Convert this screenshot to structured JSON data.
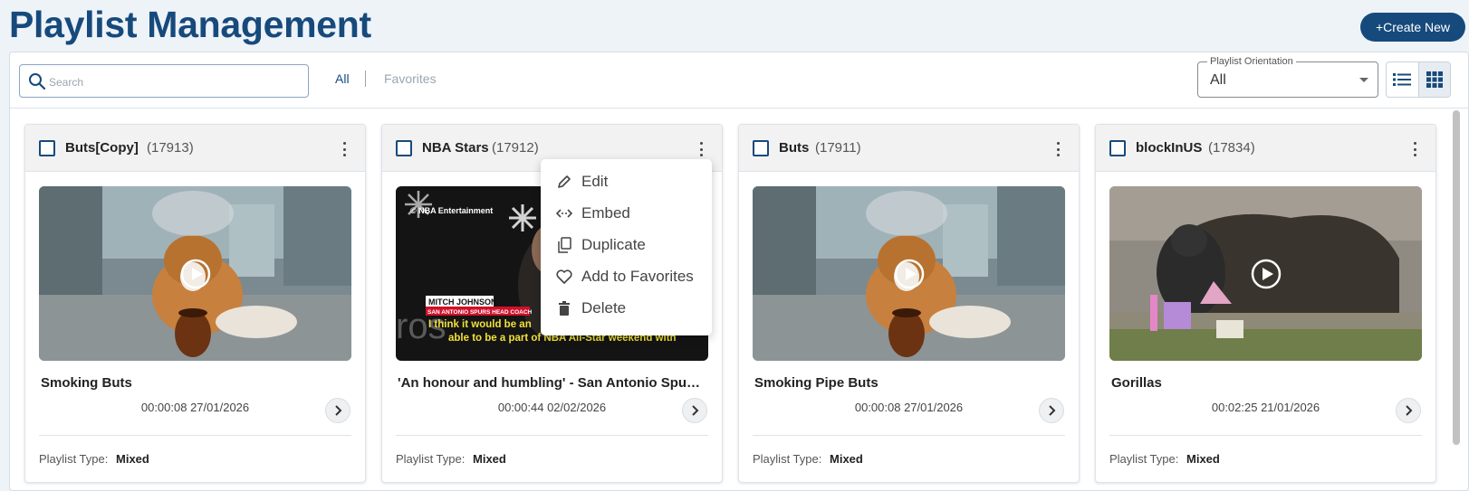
{
  "header": {
    "title": "Playlist Management",
    "create_label": "+Create New"
  },
  "toolbar": {
    "search_placeholder": "Search",
    "filter_all": "All",
    "filter_favorites": "Favorites",
    "orientation_label": "Playlist Orientation",
    "orientation_value": "All",
    "view_list_icon": "list-view-icon",
    "view_grid_icon": "grid-view-icon"
  },
  "cards": [
    {
      "name": "Buts[Copy]",
      "id": "(17913)",
      "video_title": "Smoking Buts",
      "meta": "00:00:08 27/01/2026",
      "type_label": "Playlist Type:",
      "type_value": "Mixed",
      "thumb": "dog-pipe"
    },
    {
      "name": "NBA Stars",
      "id": "(17912)",
      "video_title": "'An honour and humbling' - San Antonio Spurs' Mitch Johnson",
      "meta": "00:00:44 02/02/2026",
      "type_label": "Playlist Type:",
      "type_value": "Mixed",
      "thumb": "nba"
    },
    {
      "name": "Buts",
      "id": "(17911)",
      "video_title": "Smoking Pipe Buts",
      "meta": "00:00:08 27/01/2026",
      "type_label": "Playlist Type:",
      "type_value": "Mixed",
      "thumb": "dog-pipe"
    },
    {
      "name": "blockInUS",
      "id": "(17834)",
      "video_title": "Gorillas",
      "meta": "00:02:25 21/01/2026",
      "type_label": "Playlist Type:",
      "type_value": "Mixed",
      "thumb": "gorilla"
    }
  ],
  "nba_thumb": {
    "brand": "© NBA Entertainment",
    "name_tag": "MITCH JOHNSON",
    "role_tag": "SAN ANTONIO SPURS HEAD COACH",
    "caption_1": "I think it would be an",
    "caption_2": "able to be a part of NBA All-Star weekend with",
    "partial_word": "ros"
  },
  "context_menu": {
    "items": [
      {
        "label": "Edit",
        "icon": "pencil-icon"
      },
      {
        "label": "Embed",
        "icon": "embed-icon"
      },
      {
        "label": "Duplicate",
        "icon": "copy-icon"
      },
      {
        "label": "Add to Favorites",
        "icon": "heart-icon"
      },
      {
        "label": "Delete",
        "icon": "trash-icon"
      }
    ]
  },
  "colors": {
    "primary": "#174a7c",
    "background": "#eef3f8",
    "card_header": "#f2f2f2"
  }
}
